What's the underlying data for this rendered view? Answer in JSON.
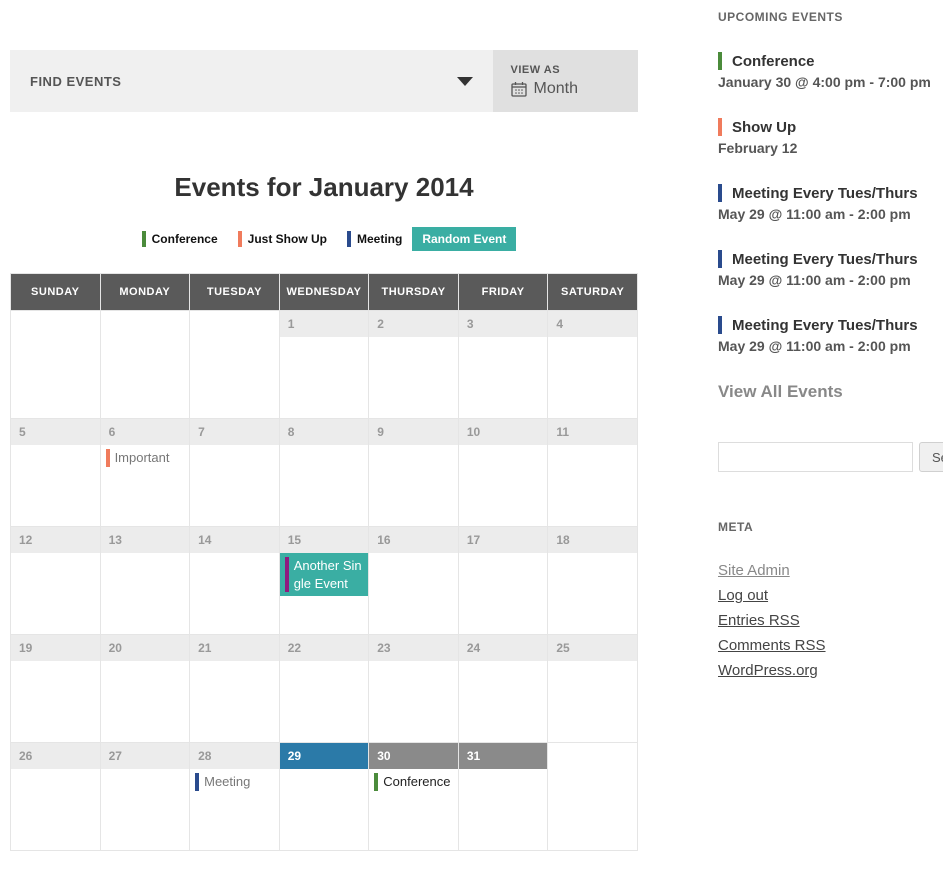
{
  "filter": {
    "find_label": "FIND EVENTS",
    "view_as_label": "VIEW AS",
    "view_as_value": "Month"
  },
  "title": "Events for January 2014",
  "legend": [
    {
      "label": "Conference",
      "color": "#4b8b3b",
      "solid": false
    },
    {
      "label": "Just Show Up",
      "color": "#f07b5c",
      "solid": false
    },
    {
      "label": "Meeting",
      "color": "#2a4b8d",
      "solid": false
    },
    {
      "label": "Random Event",
      "color": "#3aaea3",
      "solid": true
    }
  ],
  "day_headers": [
    "SUNDAY",
    "MONDAY",
    "TUESDAY",
    "WEDNESDAY",
    "THURSDAY",
    "FRIDAY",
    "SATURDAY"
  ],
  "days": {
    "d1": "1",
    "d2": "2",
    "d3": "3",
    "d4": "4",
    "d5": "5",
    "d6": "6",
    "d7": "7",
    "d8": "8",
    "d9": "9",
    "d10": "10",
    "d11": "11",
    "d12": "12",
    "d13": "13",
    "d14": "14",
    "d15": "15",
    "d16": "16",
    "d17": "17",
    "d18": "18",
    "d19": "19",
    "d20": "20",
    "d21": "21",
    "d22": "22",
    "d23": "23",
    "d24": "24",
    "d25": "25",
    "d26": "26",
    "d27": "27",
    "d28": "28",
    "d29": "29",
    "d30": "30",
    "d31": "31"
  },
  "events": {
    "d6": {
      "label": "Important",
      "bar": "#f07b5c",
      "style": "normal"
    },
    "d15": {
      "label": "Another Single Event",
      "bar": "#8e1a7f",
      "style": "teal"
    },
    "d28": {
      "label": "Meeting",
      "bar": "#2a4b8d",
      "style": "normal"
    },
    "d30": {
      "label": "Conference",
      "bar": "#4b8b3b",
      "style": "conf"
    }
  },
  "sidebar": {
    "upcoming_title": "UPCOMING EVENTS",
    "items": [
      {
        "title": "Conference",
        "date": "January 30 @ 4:00 pm - 7:00 pm",
        "bar": "#4b8b3b"
      },
      {
        "title": "Show Up",
        "date": "February 12",
        "bar": "#f07b5c"
      },
      {
        "title": "Meeting Every Tues/Thurs",
        "date": "May 29 @ 11:00 am - 2:00 pm",
        "bar": "#2a4b8d"
      },
      {
        "title": "Meeting Every Tues/Thurs",
        "date": "May 29 @ 11:00 am - 2:00 pm",
        "bar": "#2a4b8d"
      },
      {
        "title": "Meeting Every Tues/Thurs",
        "date": "May 29 @ 11:00 am - 2:00 pm",
        "bar": "#2a4b8d"
      }
    ],
    "view_all": "View All Events",
    "search_btn": "Search",
    "meta_title": "META",
    "meta_links": {
      "site_admin": "Site Admin",
      "logout": "Log out",
      "entries_rss": "Entries RSS",
      "comments_rss": "Comments RSS",
      "wporg": "WordPress.org"
    }
  }
}
